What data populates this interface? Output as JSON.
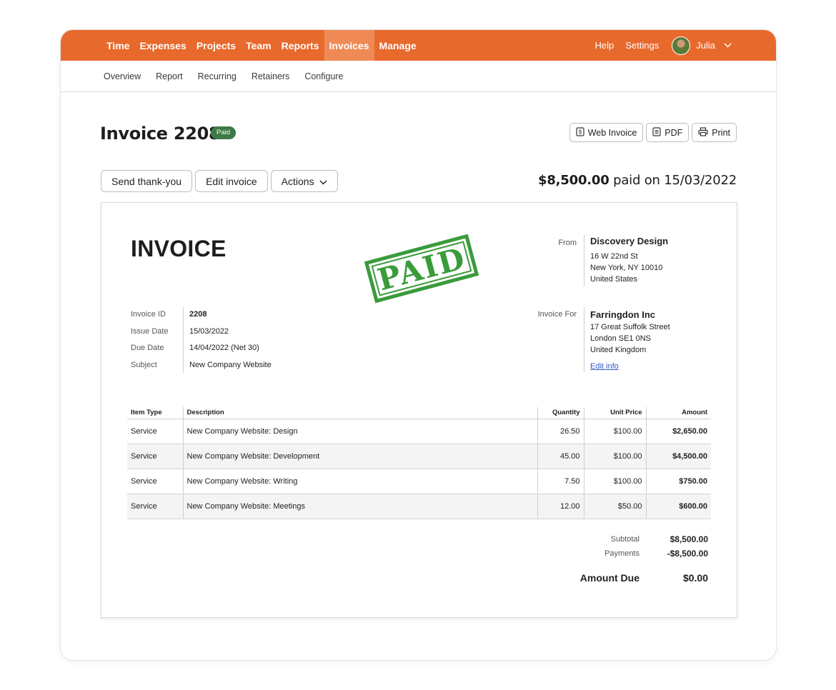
{
  "topnav": {
    "items": [
      "Time",
      "Expenses",
      "Projects",
      "Team",
      "Reports",
      "Invoices",
      "Manage"
    ],
    "active": "Invoices",
    "help": "Help",
    "settings": "Settings",
    "user": "Julia",
    "accent_color": "#e8692c"
  },
  "subnav": {
    "items": [
      "Overview",
      "Report",
      "Recurring",
      "Retainers",
      "Configure"
    ]
  },
  "header": {
    "title": "Invoice 2208",
    "badge": "Paid",
    "web_invoice": "Web Invoice",
    "pdf": "PDF",
    "print": "Print"
  },
  "actions": {
    "send_thankyou": "Send thank-you",
    "edit_invoice": "Edit invoice",
    "actions": "Actions"
  },
  "paid_summary": {
    "amount": "$8,500.00",
    "text": "paid on 15/03/2022"
  },
  "invoice": {
    "heading": "INVOICE",
    "stamp": "PAID",
    "from_label": "From",
    "from": {
      "name": "Discovery Design",
      "line1": "16 W 22nd St",
      "line2": "New York, NY 10010",
      "line3": "United States"
    },
    "for_label": "Invoice For",
    "to": {
      "name": "Farringdon Inc",
      "line1": "17 Great Suffolk Street",
      "line2": "London SE1 0NS",
      "line3": "United Kingdom",
      "edit": "Edit info"
    },
    "meta": {
      "id_label": "Invoice ID",
      "id": "2208",
      "issue_label": "Issue Date",
      "issue": "15/03/2022",
      "due_label": "Due Date",
      "due": "14/04/2022 (Net 30)",
      "subject_label": "Subject",
      "subject": "New Company Website"
    },
    "columns": [
      "Item Type",
      "Description",
      "Quantity",
      "Unit Price",
      "Amount"
    ],
    "rows": [
      {
        "type": "Service",
        "desc": "New Company Website: Design",
        "qty": "26.50",
        "unit": "$100.00",
        "amount": "$2,650.00"
      },
      {
        "type": "Service",
        "desc": "New Company Website: Development",
        "qty": "45.00",
        "unit": "$100.00",
        "amount": "$4,500.00"
      },
      {
        "type": "Service",
        "desc": "New Company Website: Writing",
        "qty": "7.50",
        "unit": "$100.00",
        "amount": "$750.00"
      },
      {
        "type": "Service",
        "desc": "New Company Website: Meetings",
        "qty": "12.00",
        "unit": "$50.00",
        "amount": "$600.00"
      }
    ],
    "totals": {
      "subtotal_label": "Subtotal",
      "subtotal": "$8,500.00",
      "payments_label": "Payments",
      "payments": "-$8,500.00",
      "due_label": "Amount Due",
      "due": "$0.00"
    },
    "stamp_color": "#3a9b3a"
  }
}
